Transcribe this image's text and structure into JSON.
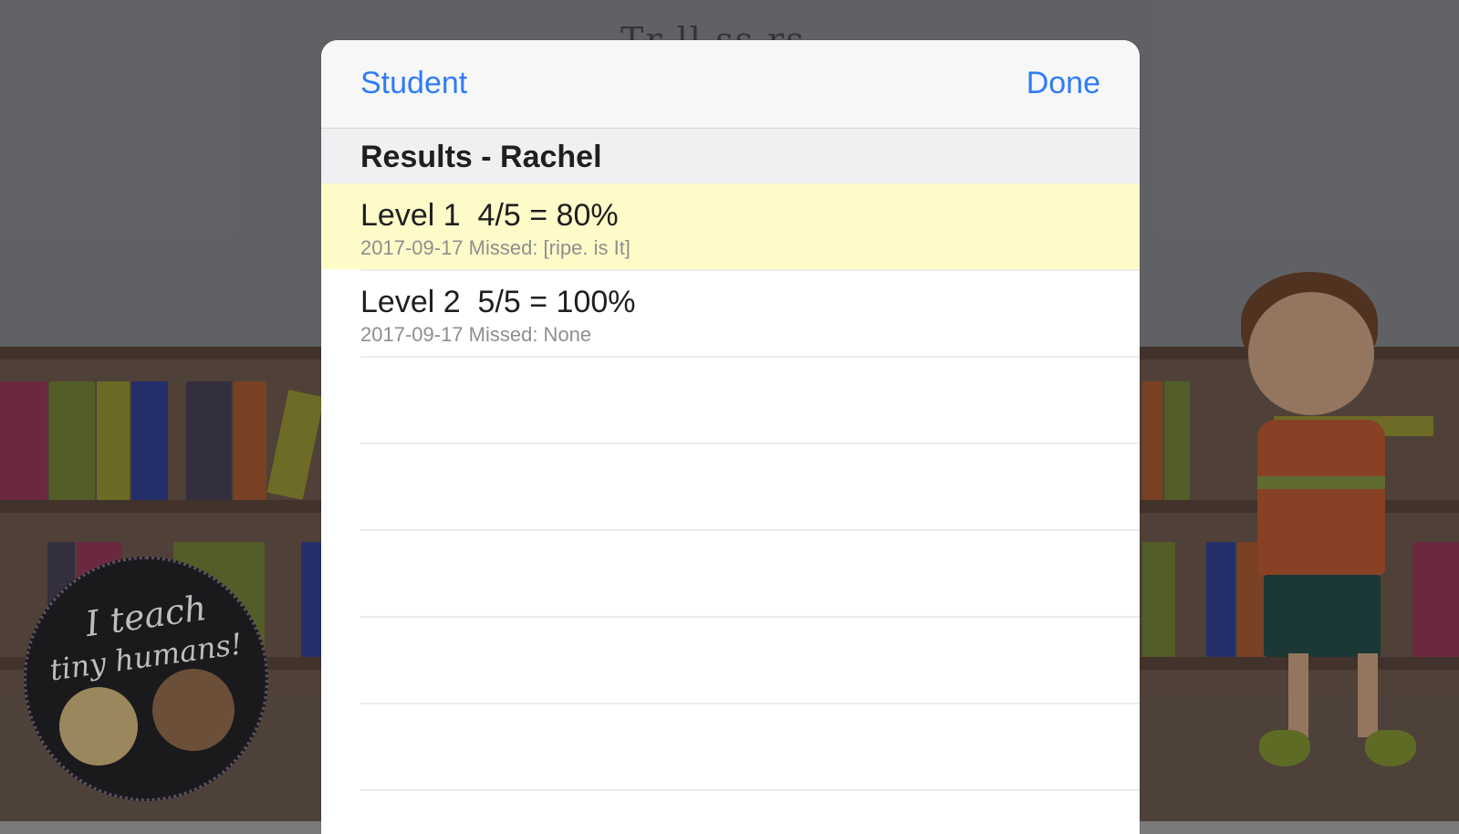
{
  "background": {
    "title_fragment": "Tr    ll   ss   rs",
    "badge_line1": "I teach",
    "badge_line2": "tiny humans!"
  },
  "modal": {
    "nav": {
      "left_label": "Student",
      "right_label": "Done"
    },
    "section_title": "Results - Rachel",
    "rows": [
      {
        "title": "Level 1  4/5 = 80%",
        "subtitle": "2017-09-17 Missed: [ripe. is It]"
      },
      {
        "title": "Level 2  5/5 = 100%",
        "subtitle": "2017-09-17 Missed: None"
      }
    ]
  },
  "colors": {
    "accent": "#2f7cf6",
    "selected_row": "#fffbc9"
  }
}
